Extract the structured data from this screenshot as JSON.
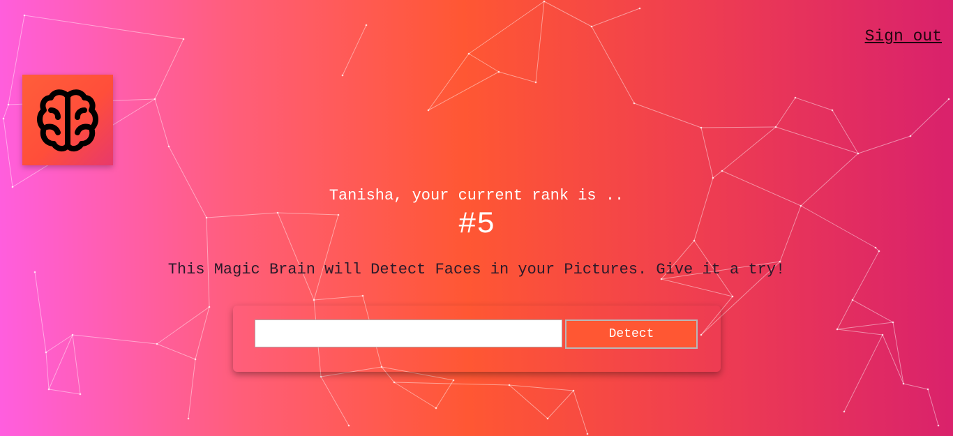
{
  "nav": {
    "sign_out_label": "Sign out"
  },
  "logo": {
    "icon": "brain-icon"
  },
  "rank": {
    "message": "Tanisha, your current rank is ..",
    "value": "#5"
  },
  "tagline": "This Magic Brain will Detect Faces in your Pictures. Give it a try!",
  "form": {
    "url_input_value": "",
    "detect_label": "Detect"
  },
  "colors": {
    "gradient": [
      "#ff5edf",
      "#ff5733",
      "#d9216c"
    ],
    "button": "#ff5733"
  }
}
